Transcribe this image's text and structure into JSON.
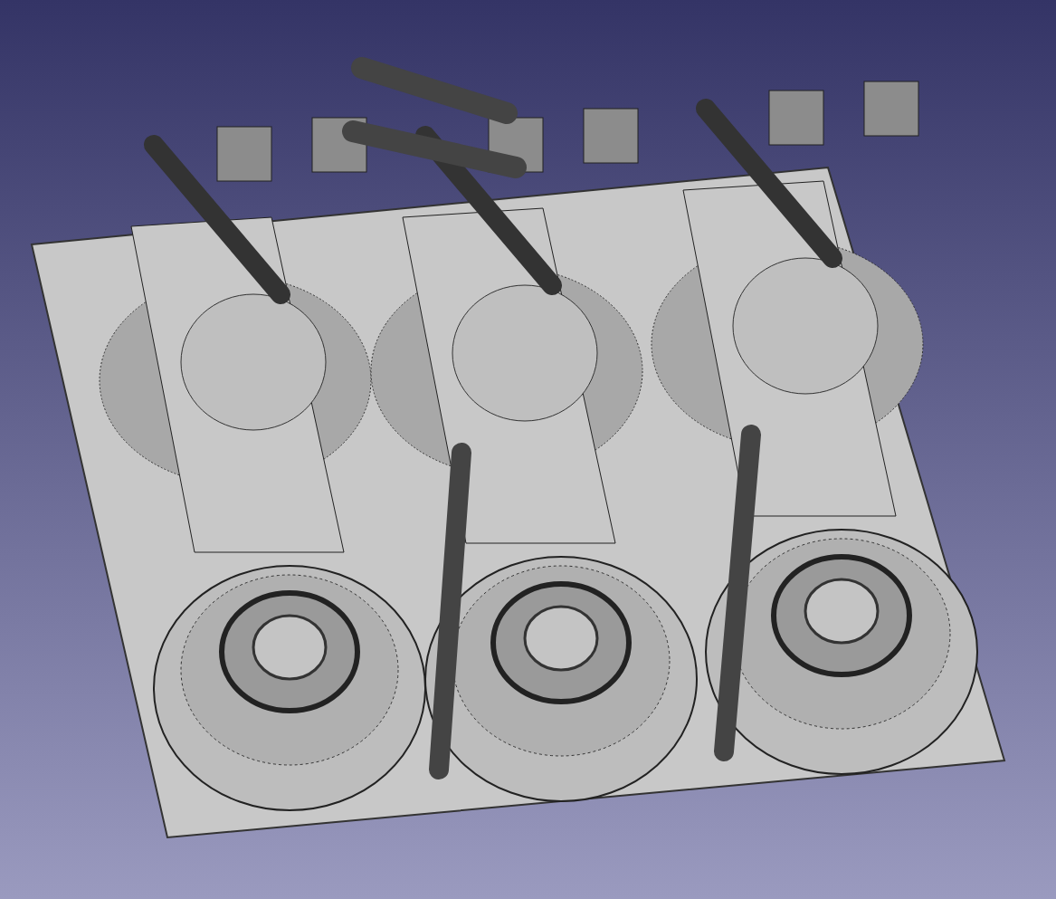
{
  "viewport": {
    "model": {
      "kind": "mesh"
    },
    "parts": [
      {
        "kind": "assembly"
      },
      {
        "kind": "assembly"
      },
      {
        "kind": "assembly"
      }
    ]
  }
}
